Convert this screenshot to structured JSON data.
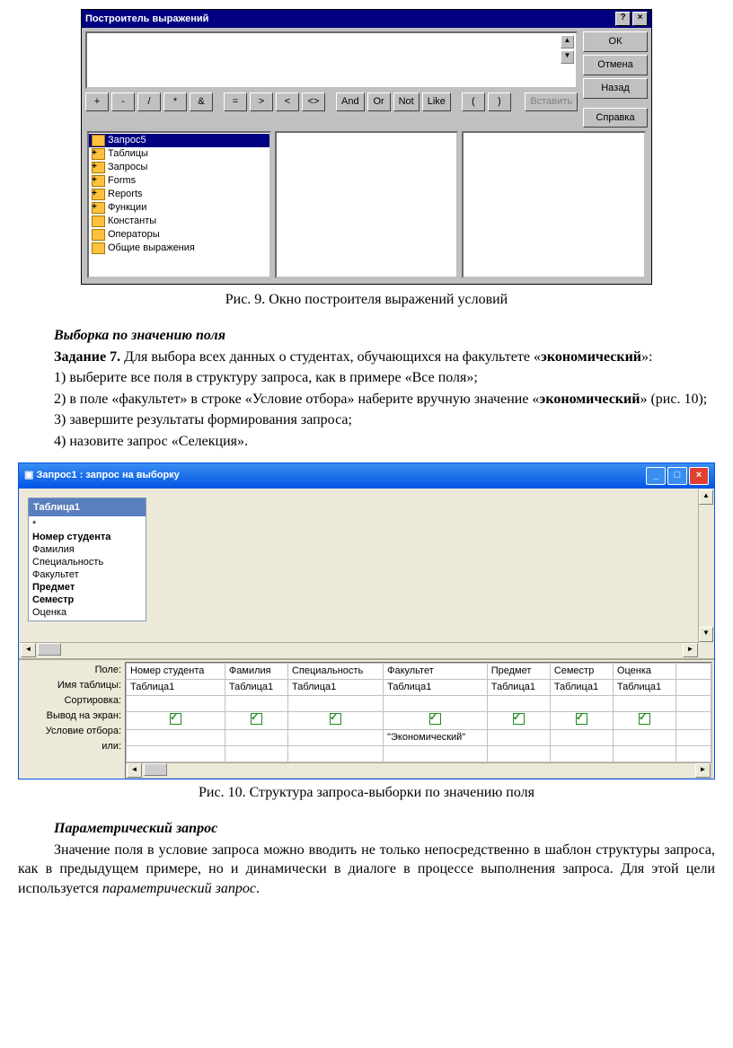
{
  "expr_builder": {
    "title": "Построитель выражений",
    "buttons": {
      "ok": "ОК",
      "cancel": "Отмена",
      "back": "Назад",
      "help": "Справка",
      "paste": "Вставить"
    },
    "ops": [
      "+",
      "-",
      "/",
      "*",
      "&",
      "=",
      ">",
      "<",
      "<>",
      "And",
      "Or",
      "Not",
      "Like",
      "(",
      ")"
    ],
    "tree": [
      {
        "label": "Запрос5",
        "sel": true,
        "plus": false
      },
      {
        "label": "Таблицы",
        "plus": true
      },
      {
        "label": "Запросы",
        "plus": true
      },
      {
        "label": "Forms",
        "plus": true
      },
      {
        "label": "Reports",
        "plus": true
      },
      {
        "label": "Функции",
        "plus": true
      },
      {
        "label": "Константы",
        "plus": false
      },
      {
        "label": "Операторы",
        "plus": false
      },
      {
        "label": "Общие выражения",
        "plus": false
      }
    ]
  },
  "text": {
    "cap9": "Рис. 9. Окно построителя выражений условий",
    "h1": "Выборка по значению поля",
    "p1a": "Задание 7.",
    "p1b": " Для выбора всех данных о студентах, обучающихся на факультете «",
    "p1c": "экономический",
    "p1d": "»:",
    "p2": "1) выберите все поля в структуру запроса, как в примере «Все поля»;",
    "p3": "2) в поле «факультет» в строке «Условие отбора» наберите вручную значение «",
    "p3b": "экономический",
    "p3c": "» (рис. 10);",
    "p4": "3) завершите результаты формирования запроса;",
    "p5": "4) назовите запрос «Селекция».",
    "cap10": "Рис. 10. Структура запроса-выборки по значению поля",
    "h2": "Параметрический запрос",
    "p6": "Значение поля в условие запроса можно вводить не только непосредственно в шаблон структуры запроса, как в предыдущем примере, но и динамически в диалоге в процессе выполнения запроса. Для этой цели используется ",
    "p6b": "параметрический запрос",
    "p6c": "."
  },
  "query": {
    "title": "Запрос1 : запрос на выборку",
    "table_card": {
      "name": "Таблица1",
      "fields": [
        "*",
        "Номер студента",
        "Фамилия",
        "Специальность",
        "Факультет",
        "Предмет",
        "Семестр",
        "Оценка"
      ],
      "bold": [
        1,
        5,
        6
      ]
    },
    "row_labels": [
      "Поле:",
      "Имя таблицы:",
      "Сортировка:",
      "Вывод на экран:",
      "Условие отбора:",
      "или:"
    ],
    "columns": [
      {
        "field": "Номер студента",
        "table": "Таблица1",
        "show": true,
        "cond": ""
      },
      {
        "field": "Фамилия",
        "table": "Таблица1",
        "show": true,
        "cond": ""
      },
      {
        "field": "Специальность",
        "table": "Таблица1",
        "show": true,
        "cond": ""
      },
      {
        "field": "Факультет",
        "table": "Таблица1",
        "show": true,
        "cond": "\"Экономический\""
      },
      {
        "field": "Предмет",
        "table": "Таблица1",
        "show": true,
        "cond": ""
      },
      {
        "field": "Семестр",
        "table": "Таблица1",
        "show": true,
        "cond": ""
      },
      {
        "field": "Оценка",
        "table": "Таблица1",
        "show": true,
        "cond": ""
      }
    ]
  }
}
